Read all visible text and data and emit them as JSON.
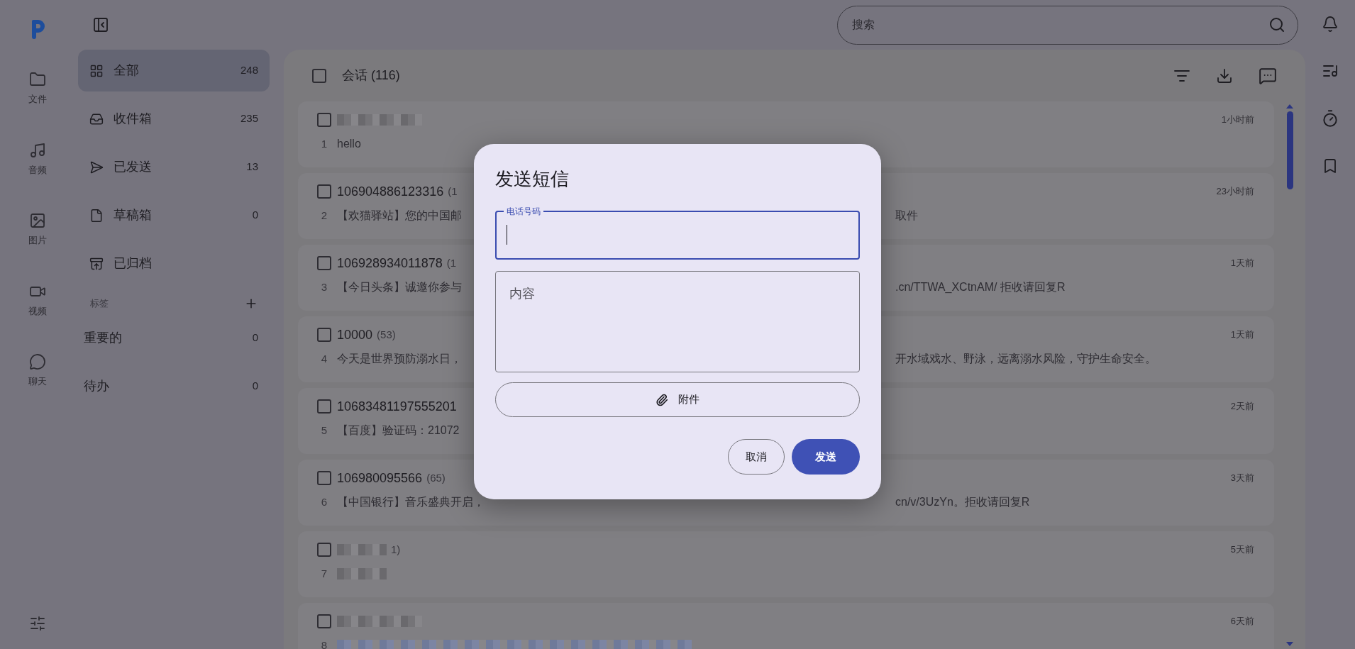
{
  "rail": [
    {
      "label": "文件"
    },
    {
      "label": "音频"
    },
    {
      "label": "图片"
    },
    {
      "label": "视频"
    },
    {
      "label": "聊天"
    }
  ],
  "nav": [
    {
      "label": "全部",
      "count": "248",
      "selected": true
    },
    {
      "label": "收件箱",
      "count": "235",
      "selected": false
    },
    {
      "label": "已发送",
      "count": "13",
      "selected": false
    },
    {
      "label": "草稿箱",
      "count": "0",
      "selected": false
    },
    {
      "label": "已归档",
      "selected": false
    }
  ],
  "tags": {
    "title": "标签",
    "items": [
      {
        "label": "重要的",
        "count": "0"
      },
      {
        "label": "待办",
        "count": "0"
      }
    ]
  },
  "search": {
    "placeholder": "搜索"
  },
  "list_header": {
    "title": "会话 (116)",
    "checked": false
  },
  "rows": [
    {
      "index": "1",
      "title_redacted": true,
      "preview": "hello",
      "time": "1小时前",
      "checked": false
    },
    {
      "index": "2",
      "title": "106904886123316",
      "count": "(1",
      "preview": "【欢猫驿站】您的中国邮",
      "preview_tail": "取件",
      "time": "23小时前",
      "checked": false
    },
    {
      "index": "3",
      "title": "106928934011878",
      "count": "(1",
      "preview": "【今日头条】诚邀你参与",
      "preview_tail": ".cn/TTWA_XCtnAM/ 拒收请回复R",
      "time": "1天前",
      "checked": false
    },
    {
      "index": "4",
      "title": "10000",
      "count": "(53)",
      "preview": "今天是世界预防溺水日，",
      "preview_tail": "开水域戏水、野泳，远离溺水风险，守护生命安全。",
      "time": "1天前",
      "checked": false
    },
    {
      "index": "5",
      "title": "10683481197555201",
      "preview": "【百度】验证码：21072",
      "time": "2天前",
      "checked": false
    },
    {
      "index": "6",
      "title": "106980095566",
      "count": "(65)",
      "preview": "【中国银行】音乐盛典开启，",
      "preview_tail": "cn/v/3UzYn。拒收请回复R",
      "time": "3天前",
      "checked": false
    },
    {
      "index": "7",
      "title_redacted": true,
      "count": "1)",
      "preview_redacted": true,
      "time": "5天前",
      "checked": false
    },
    {
      "index": "8",
      "title_redacted": true,
      "preview_redacted": true,
      "time": "6天前",
      "checked": false
    }
  ],
  "dialog": {
    "title": "发送短信",
    "phone_field": {
      "label": "电话号码",
      "focused": true
    },
    "content_field": {
      "placeholder": "内容"
    },
    "attach_button": "附件",
    "buttons": [
      {
        "label": "取消",
        "kind": "outlined"
      },
      {
        "label": "发送",
        "kind": "filled"
      }
    ]
  }
}
